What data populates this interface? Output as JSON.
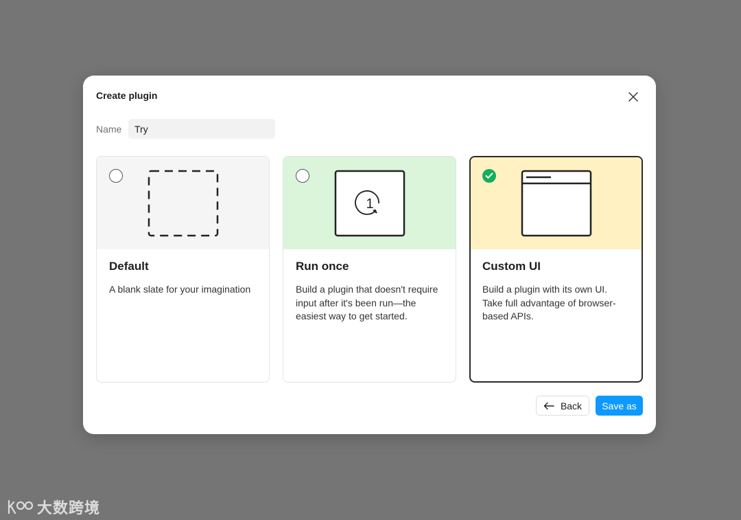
{
  "dialog": {
    "title": "Create plugin",
    "name_label": "Name",
    "name_value": "Try",
    "back_label": "Back",
    "save_label": "Save as"
  },
  "cards": [
    {
      "title": "Default",
      "desc": "A blank slate for your imagination",
      "selected": false,
      "bg": "#f5f5f5",
      "icon": "dashed-square-icon"
    },
    {
      "title": "Run once",
      "desc": "Build a plugin that doesn't require input after it's been run—the easiest way to get started.",
      "selected": false,
      "bg": "#daf5da",
      "icon": "run-once-icon"
    },
    {
      "title": "Custom UI",
      "desc": "Build a plugin with its own UI. Take full advantage of browser-based APIs.",
      "selected": true,
      "bg": "#fff1c2",
      "icon": "window-icon"
    }
  ],
  "colors": {
    "accent": "#0d99ff",
    "check": "#14ae5c",
    "overlay": "#757575"
  },
  "watermark": "大数跨境"
}
